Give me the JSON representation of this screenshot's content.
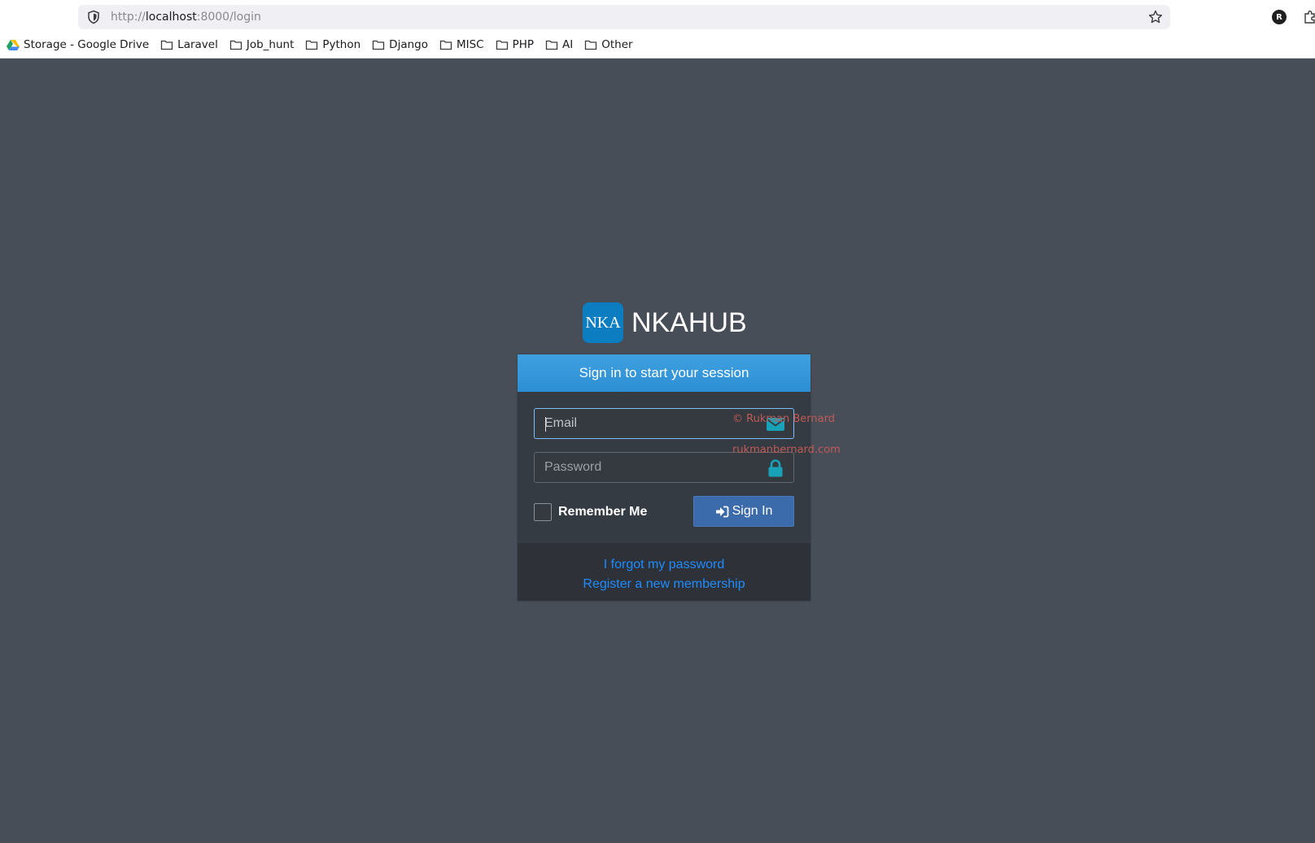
{
  "browser": {
    "url_scheme": "http://",
    "url_host": "localhost",
    "url_rest": ":8000/login",
    "profile_initial": "R",
    "bookmarks": [
      {
        "label": "Storage - Google Drive",
        "icon": "google-drive-icon"
      },
      {
        "label": "Laravel",
        "icon": "folder-icon"
      },
      {
        "label": "Job_hunt",
        "icon": "folder-icon"
      },
      {
        "label": "Python",
        "icon": "folder-icon"
      },
      {
        "label": "Django",
        "icon": "folder-icon"
      },
      {
        "label": "MISC",
        "icon": "folder-icon"
      },
      {
        "label": "PHP",
        "icon": "folder-icon"
      },
      {
        "label": "AI",
        "icon": "folder-icon"
      },
      {
        "label": "Other",
        "icon": "folder-icon"
      }
    ]
  },
  "brand": {
    "logo_text": "NKA",
    "name": "NKAHUB",
    "logo_color": "#0b7dc0"
  },
  "login": {
    "header": "Sign in to start your session",
    "email_placeholder": "Email",
    "password_placeholder": "Password",
    "remember_label": "Remember Me",
    "signin_label": "Sign In",
    "forgot_link": "I forgot my password",
    "register_link": "Register a new membership",
    "accent_color": "#3fa0e0",
    "button_color": "#3c6bab",
    "link_color": "#1e8cff"
  },
  "watermark": {
    "line1": "© Rukman Bernard",
    "line2": "rukmanbernard.com"
  }
}
